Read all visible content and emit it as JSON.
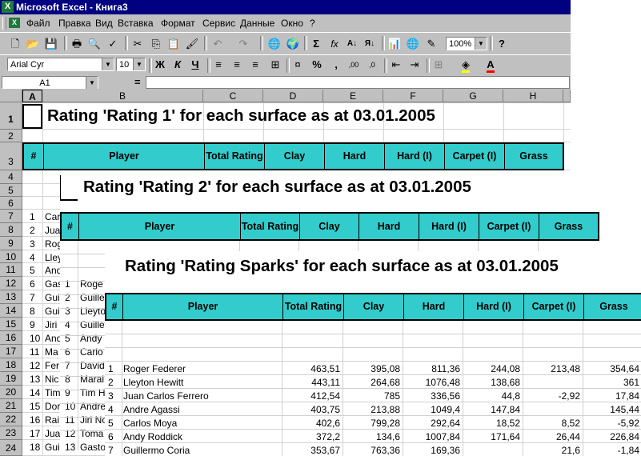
{
  "window": {
    "title": "Microsoft Excel - Книга3",
    "app_icon": "excel-icon"
  },
  "menu": [
    "Файл",
    "Правка",
    "Вид",
    "Вставка",
    "Формат",
    "Сервис",
    "Данные",
    "Окно",
    "?"
  ],
  "toolbar": {
    "zoom": "100%",
    "font": "Arial Cyr",
    "font_size": "10",
    "bold": "Ж",
    "italic": "К",
    "underline": "Ч"
  },
  "formula_bar": {
    "name_box": "A1",
    "equals": "="
  },
  "columns": [
    "A",
    "B",
    "C",
    "D",
    "E",
    "F",
    "G",
    "H"
  ],
  "rows": [
    "1",
    "2",
    "3",
    "4",
    "5",
    "6",
    "7",
    "8",
    "9",
    "10",
    "11",
    "12",
    "13",
    "14",
    "15",
    "16",
    "17",
    "18",
    "19",
    "20",
    "21",
    "22",
    "23",
    "24"
  ],
  "header_labels": [
    "#",
    "Player",
    "Total Rating",
    "Clay",
    "Hard",
    "Hard (I)",
    "Carpet (I)",
    "Grass"
  ],
  "sheet1": {
    "title": "Rating 'Rating 1' for each surface as at 03.01.2005",
    "index": [
      "1",
      "2",
      "3",
      "4",
      "5",
      "6",
      "7",
      "8",
      "9",
      "10",
      "11",
      "12",
      "13",
      "14",
      "15",
      "16",
      "17",
      "18"
    ],
    "players_clipped": [
      "Car",
      "Jua",
      "Rog",
      "Lley",
      "And",
      "Gas",
      "Gui",
      "Gui",
      "Jiri",
      "And",
      "Ma",
      "Fer",
      "Nic",
      "Tim",
      "Dor",
      "Rai",
      "Jua",
      "Gui"
    ]
  },
  "sheet2": {
    "title": "Rating 'Rating 2' for each surface as at 03.01.2005",
    "index": [
      "1",
      "2",
      "3",
      "4",
      "5",
      "6",
      "7",
      "8",
      "9",
      "10",
      "11",
      "12",
      "13"
    ],
    "players_clipped": [
      "Roge",
      "Guille",
      "Lleyto",
      "Guille",
      "Andy",
      "Carlo",
      "David",
      "Maral",
      "Tim H",
      "Andre",
      "Jiri No",
      "Toma",
      "Gasto"
    ]
  },
  "sheet3": {
    "title": "Rating 'Rating Sparks' for each surface as at 03.01.2005",
    "rows": [
      {
        "n": "1",
        "player": "Roger Federer",
        "total": "463,51",
        "clay": "395,08",
        "hard": "811,36",
        "hardi": "244,08",
        "carpet": "213,48",
        "grass": "354,64"
      },
      {
        "n": "2",
        "player": "Lleyton Hewitt",
        "total": "443,11",
        "clay": "264,68",
        "hard": "1076,48",
        "hardi": "138,68",
        "carpet": "",
        "grass": "361"
      },
      {
        "n": "3",
        "player": "Juan Carlos Ferrero",
        "total": "412,54",
        "clay": "785",
        "hard": "336,56",
        "hardi": "44,8",
        "carpet": "-2,92",
        "grass": "17,84"
      },
      {
        "n": "4",
        "player": "Andre Agassi",
        "total": "403,75",
        "clay": "213,88",
        "hard": "1049,4",
        "hardi": "147,84",
        "carpet": "",
        "grass": "145,44"
      },
      {
        "n": "5",
        "player": "Carlos Moya",
        "total": "402,6",
        "clay": "799,28",
        "hard": "292,64",
        "hardi": "18,52",
        "carpet": "8,52",
        "grass": "-5,92"
      },
      {
        "n": "6",
        "player": "Andy Roddick",
        "total": "372,2",
        "clay": "134,6",
        "hard": "1007,84",
        "hardi": "171,64",
        "carpet": "26,44",
        "grass": "226,84"
      },
      {
        "n": "7",
        "player": "Guillermo Coria",
        "total": "353,67",
        "clay": "763,36",
        "hard": "169,36",
        "hardi": "",
        "carpet": "21,6",
        "grass": "-1,84"
      }
    ]
  }
}
